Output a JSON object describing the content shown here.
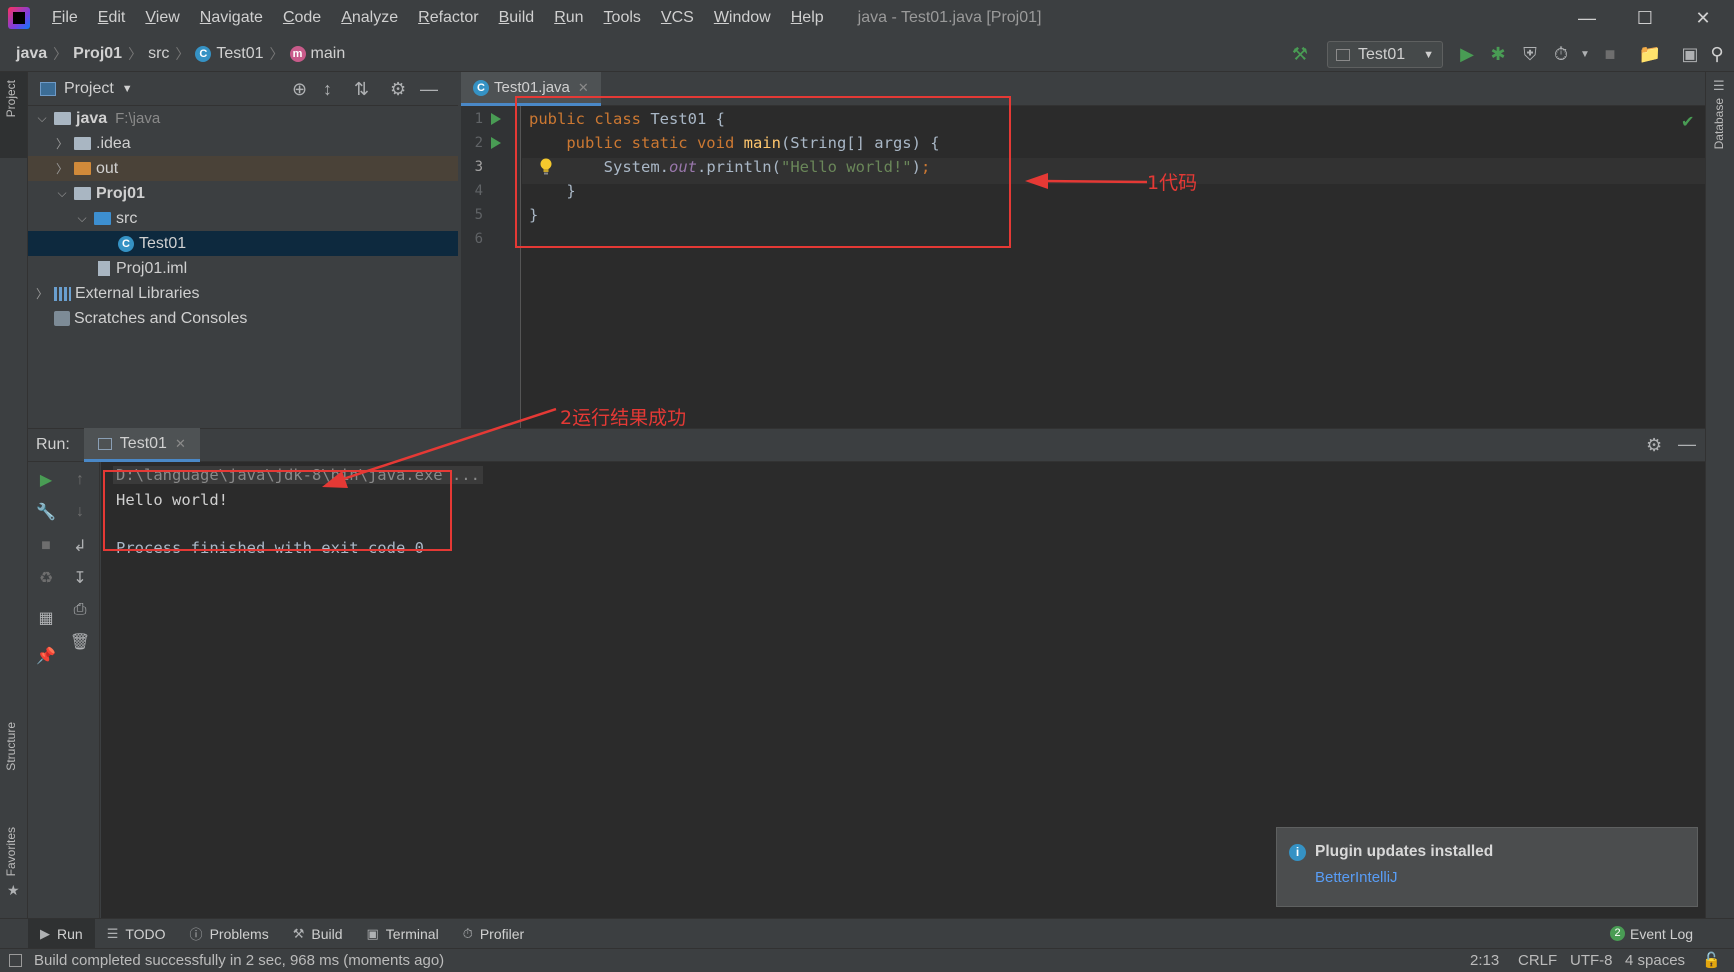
{
  "menubar": {
    "items": [
      "File",
      "Edit",
      "View",
      "Navigate",
      "Code",
      "Analyze",
      "Refactor",
      "Build",
      "Run",
      "Tools",
      "VCS",
      "Window",
      "Help"
    ],
    "window_title": "java - Test01.java [Proj01]"
  },
  "navbar": {
    "crumbs": [
      "java",
      "Proj01",
      "src",
      "Test01",
      "main"
    ],
    "run_config": "Test01"
  },
  "project": {
    "header": "Project",
    "tree": [
      {
        "label": "java",
        "hint": "F:\\java"
      },
      {
        "label": ".idea"
      },
      {
        "label": "out"
      },
      {
        "label": "Proj01"
      },
      {
        "label": "src"
      },
      {
        "label": "Test01"
      },
      {
        "label": "Proj01.iml"
      },
      {
        "label": "External Libraries"
      },
      {
        "label": "Scratches and Consoles"
      }
    ]
  },
  "editor": {
    "tab": "Test01.java",
    "line_numbers": [
      "1",
      "2",
      "3",
      "4",
      "5",
      "6"
    ]
  },
  "annotations": {
    "code_label": "1代码",
    "run_label": "2运行结果成功"
  },
  "left_stripe": {
    "project": "Project",
    "structure": "Structure",
    "favorites": "Favorites"
  },
  "right_stripe": {
    "database": "Database"
  },
  "run_panel": {
    "label": "Run:",
    "tab": "Test01",
    "console": [
      "D:\\language\\java\\jdk-8\\bin\\java.exe ...",
      "Hello world!",
      "Process finished with exit code 0"
    ]
  },
  "notification": {
    "title": "Plugin updates installed",
    "link": "BetterIntelliJ"
  },
  "toolwindows": [
    "Run",
    "TODO",
    "Problems",
    "Build",
    "Terminal",
    "Profiler"
  ],
  "event_log": {
    "count": "2",
    "label": "Event Log"
  },
  "status": {
    "message": "Build completed successfully in 2 sec, 968 ms (moments ago)",
    "position": "2:13",
    "line_sep": "CRLF",
    "encoding": "UTF-8",
    "indent": "4 spaces"
  },
  "colors": {
    "accent": "#4a88c7",
    "annotation": "#e53935",
    "run_green": "#499c54"
  }
}
